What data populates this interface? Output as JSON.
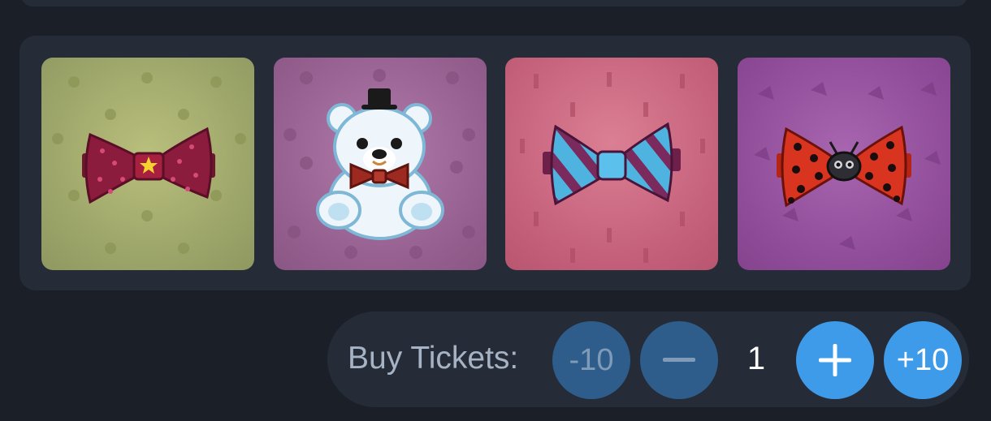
{
  "prizes": [
    {
      "name": "cherry-bow-tie",
      "accent": "#8c1c3d"
    },
    {
      "name": "teddy-bear",
      "accent": "#ffffff"
    },
    {
      "name": "striped-bow-tie",
      "accent": "#4fb3e0"
    },
    {
      "name": "ladybug-bow-tie",
      "accent": "#d9341f"
    }
  ],
  "ticket_bar": {
    "label": "Buy Tickets:",
    "minus_ten": "-10",
    "quantity": "1",
    "plus_ten": "+10"
  },
  "colors": {
    "background": "#1b2028",
    "panel": "#252c37",
    "button_active": "#3d9bea",
    "button_disabled": "#2f5d8b"
  }
}
